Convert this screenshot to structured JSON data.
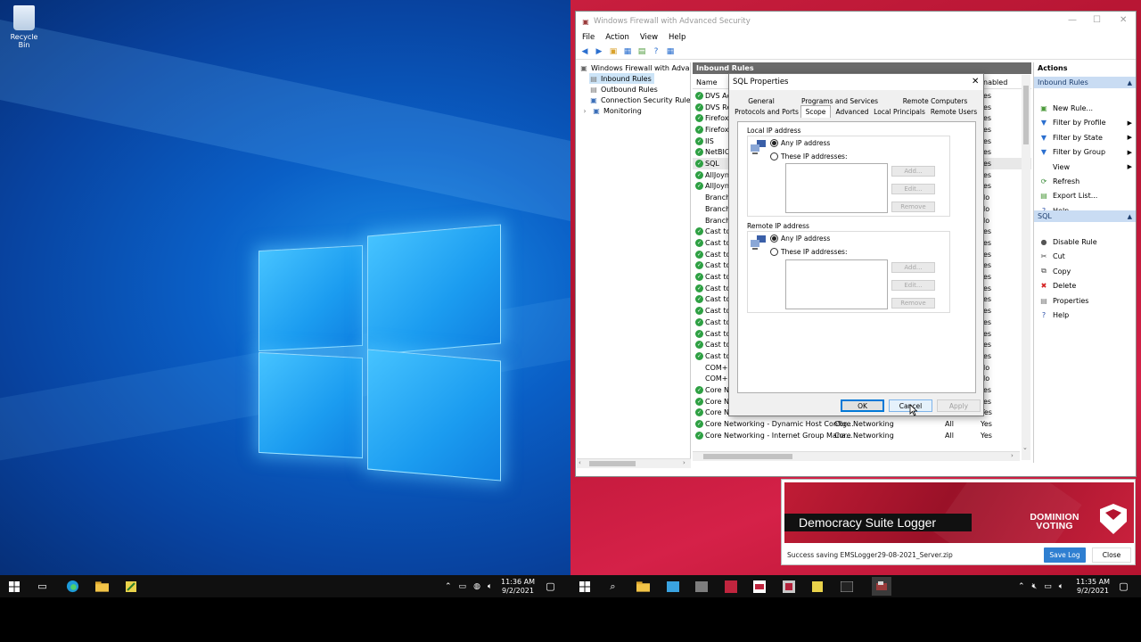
{
  "desktop_left": {
    "recycle_bin_label": "Recycle Bin",
    "taskbar": {
      "clock_time": "11:36 AM",
      "clock_date": "9/2/2021"
    }
  },
  "desktop_right": {
    "taskbar": {
      "clock_time": "11:35 AM",
      "clock_date": "9/2/2021"
    }
  },
  "mmc": {
    "title": "Windows Firewall with Advanced Security",
    "menu": [
      "File",
      "Action",
      "View",
      "Help"
    ],
    "tree": [
      "Windows Firewall with Advance",
      "Inbound Rules",
      "Outbound Rules",
      "Connection Security Rules",
      "Monitoring"
    ],
    "center_header": "Inbound Rules",
    "columns": {
      "name": "Name",
      "enabled": "nabled"
    },
    "rules": [
      {
        "name": "DVS Ac",
        "enabled": "es",
        "check": true
      },
      {
        "name": "DVS Re",
        "enabled": "es",
        "check": true
      },
      {
        "name": "Firefox",
        "enabled": "es",
        "check": true
      },
      {
        "name": "Firefox",
        "enabled": "es",
        "check": true
      },
      {
        "name": "IIS",
        "enabled": "es",
        "check": true
      },
      {
        "name": "NetBIO",
        "enabled": "es",
        "check": true
      },
      {
        "name": "SQL",
        "enabled": "es",
        "check": true
      },
      {
        "name": "AllJoyn",
        "enabled": "es",
        "check": true
      },
      {
        "name": "AllJoyn",
        "enabled": "es",
        "check": true
      },
      {
        "name": "Branch",
        "enabled": "lo",
        "check": false
      },
      {
        "name": "Branch",
        "enabled": "lo",
        "check": false
      },
      {
        "name": "Branch",
        "enabled": "lo",
        "check": false
      },
      {
        "name": "Cast to",
        "enabled": "es",
        "check": true
      },
      {
        "name": "Cast to",
        "enabled": "es",
        "check": true
      },
      {
        "name": "Cast to",
        "enabled": "es",
        "check": true
      },
      {
        "name": "Cast to",
        "enabled": "es",
        "check": true
      },
      {
        "name": "Cast to",
        "enabled": "es",
        "check": true
      },
      {
        "name": "Cast to",
        "enabled": "es",
        "check": true
      },
      {
        "name": "Cast to",
        "enabled": "es",
        "check": true
      },
      {
        "name": "Cast to",
        "enabled": "es",
        "check": true
      },
      {
        "name": "Cast to",
        "enabled": "es",
        "check": true
      },
      {
        "name": "Cast to",
        "enabled": "es",
        "check": true
      },
      {
        "name": "Cast to",
        "enabled": "es",
        "check": true
      },
      {
        "name": "Cast to",
        "enabled": "es",
        "check": true
      },
      {
        "name": "COM+",
        "enabled": "lo",
        "check": false
      },
      {
        "name": "COM+",
        "enabled": "lo",
        "check": false
      },
      {
        "name": "Core N",
        "enabled": "es",
        "check": true
      },
      {
        "name": "Core N",
        "enabled": "es",
        "check": true
      }
    ],
    "full_rules": [
      {
        "name": "Core Networking - Dynamic Host Config...",
        "group": "Core Networking",
        "profile": "All",
        "enabled": "Yes"
      },
      {
        "name": "Core Networking - Dynamic Host Config...",
        "group": "Core Networking",
        "profile": "All",
        "enabled": "Yes"
      },
      {
        "name": "Core Networking - Internet Group Mana...",
        "group": "Core Networking",
        "profile": "All",
        "enabled": "Yes"
      }
    ],
    "actions": {
      "header": "Actions",
      "section1": "Inbound Rules",
      "items1": [
        "New Rule...",
        "Filter by Profile",
        "Filter by State",
        "Filter by Group",
        "View",
        "Refresh",
        "Export List...",
        "Help"
      ],
      "section2": "SQL",
      "items2": [
        "Disable Rule",
        "Cut",
        "Copy",
        "Delete",
        "Properties",
        "Help"
      ]
    }
  },
  "dialog": {
    "title": "SQL Properties",
    "tabs_row1": [
      "General",
      "Programs and Services",
      "Remote Computers"
    ],
    "tabs_row2": [
      "Protocols and Ports",
      "Scope",
      "Advanced",
      "Local Principals",
      "Remote Users"
    ],
    "local_group": "Local IP address",
    "remote_group": "Remote IP address",
    "any_ip": "Any IP address",
    "these_ip": "These IP addresses:",
    "add": "Add...",
    "edit": "Edit...",
    "remove": "Remove",
    "ok": "OK",
    "cancel": "Cancel",
    "apply": "Apply"
  },
  "logger": {
    "title": "Democracy Suite Logger",
    "brand_line1": "DOMINION",
    "brand_line2": "VOTING",
    "status": "Success saving EMSLogger29-08-2021_Server.zip",
    "save_label": "Save Log",
    "close_label": "Close"
  }
}
